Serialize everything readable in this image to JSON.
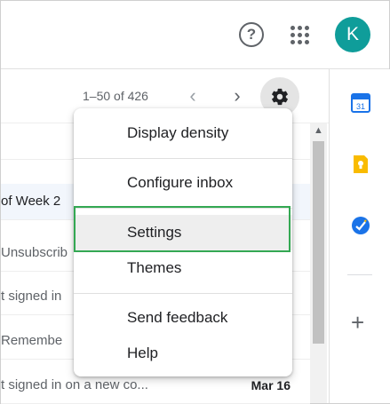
{
  "header": {
    "help_icon_glyph": "?",
    "avatar_letter": "K",
    "avatar_color": "#0f9d9a"
  },
  "toolbar": {
    "range": "1–50 of 426",
    "prev_glyph": "‹",
    "next_glyph": "›"
  },
  "list": {
    "rows": [
      {
        "text": "",
        "date": ""
      },
      {
        "text": "of Week 2",
        "date": ""
      },
      {
        "text": "Unsubscrib",
        "date": ""
      },
      {
        "text": "t signed in",
        "date": ""
      },
      {
        "text": "Remembe",
        "date": ""
      },
      {
        "text": "",
        "date": ""
      },
      {
        "text": "t signed in on a new co...",
        "date": "Mar 16"
      }
    ]
  },
  "menu": {
    "items": [
      {
        "label": "Display density"
      },
      {
        "label": "Configure inbox"
      },
      {
        "label": "Settings"
      },
      {
        "label": "Themes"
      },
      {
        "label": "Send feedback"
      },
      {
        "label": "Help"
      }
    ]
  },
  "side": {
    "calendar_day": "31",
    "plus_glyph": "+"
  },
  "colors": {
    "accent_highlight": "#34a853",
    "keep_yellow": "#f9bb00",
    "tasks_blue": "#1a73e8"
  }
}
